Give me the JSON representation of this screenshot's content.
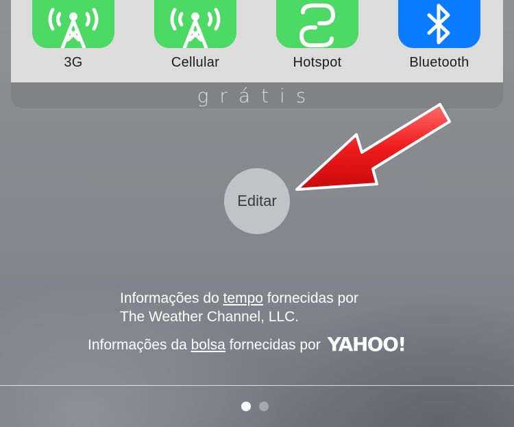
{
  "widget": {
    "apps": [
      {
        "label": "3G",
        "icon": "antenna-icon",
        "color": "#4cd964"
      },
      {
        "label": "Cellular",
        "icon": "antenna-icon",
        "color": "#4cd964"
      },
      {
        "label": "Hotspot",
        "icon": "hotspot-chain-icon",
        "color": "#4cd964"
      },
      {
        "label": "Bluetooth",
        "icon": "bluetooth-icon",
        "color": "#0a7cff"
      }
    ],
    "footer_text": "grátis"
  },
  "edit_button": {
    "label": "Editar"
  },
  "annotation": {
    "icon": "red-arrow-icon",
    "color": "#ee1111"
  },
  "credits": {
    "weather_prefix": "Informações do ",
    "weather_link": "tempo",
    "weather_suffix": " fornecidas por",
    "weather_line2": "The Weather Channel, LLC.",
    "stocks_prefix": "Informações da ",
    "stocks_link": "bolsa",
    "stocks_suffix": " fornecidas por",
    "stocks_logo": "YAHOO!"
  },
  "pagination": {
    "current_page": 1,
    "total_pages": 2
  }
}
